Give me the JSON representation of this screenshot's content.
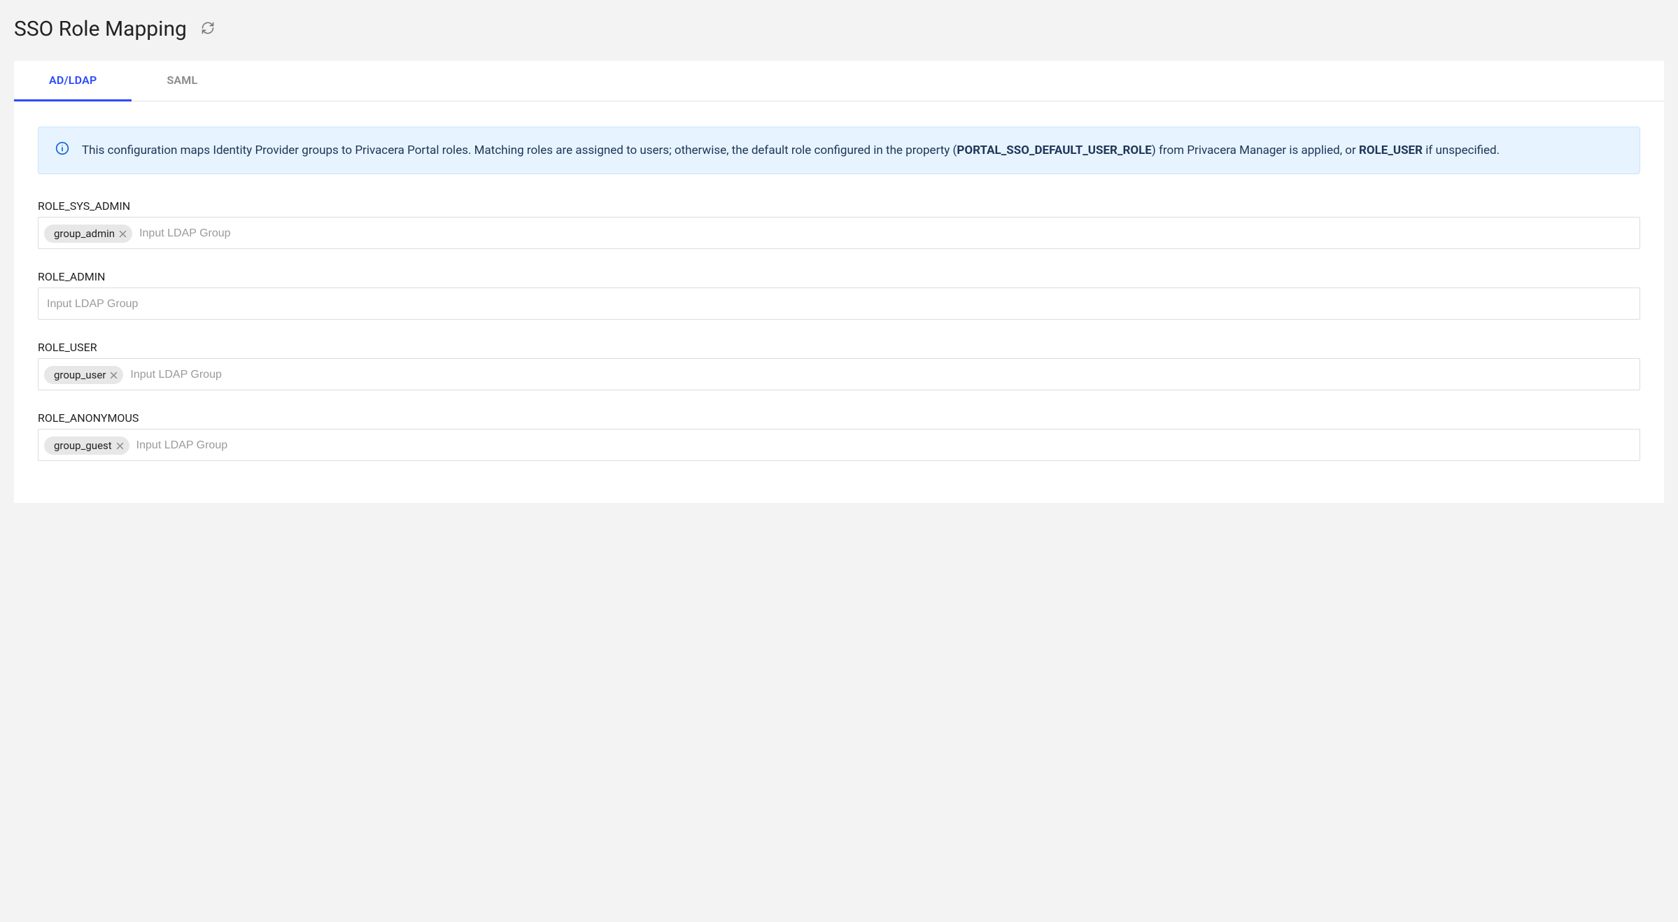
{
  "header": {
    "title": "SSO Role Mapping"
  },
  "tabs": [
    {
      "label": "AD/LDAP",
      "active": true
    },
    {
      "label": "SAML",
      "active": false
    }
  ],
  "info": {
    "text_before_bold1": "This configuration maps Identity Provider groups to Privacera Portal roles. Matching roles are assigned to users; otherwise, the default role configured in the property (",
    "bold1": "PORTAL_SSO_DEFAULT_USER_ROLE",
    "text_mid": ") from Privacera Manager is applied, or ",
    "bold2": "ROLE_USER",
    "text_after": " if unspecified."
  },
  "placeholder": "Input LDAP Group",
  "roles": [
    {
      "name": "ROLE_SYS_ADMIN",
      "tags": [
        "group_admin"
      ]
    },
    {
      "name": "ROLE_ADMIN",
      "tags": []
    },
    {
      "name": "ROLE_USER",
      "tags": [
        "group_user"
      ]
    },
    {
      "name": "ROLE_ANONYMOUS",
      "tags": [
        "group_guest"
      ]
    }
  ]
}
